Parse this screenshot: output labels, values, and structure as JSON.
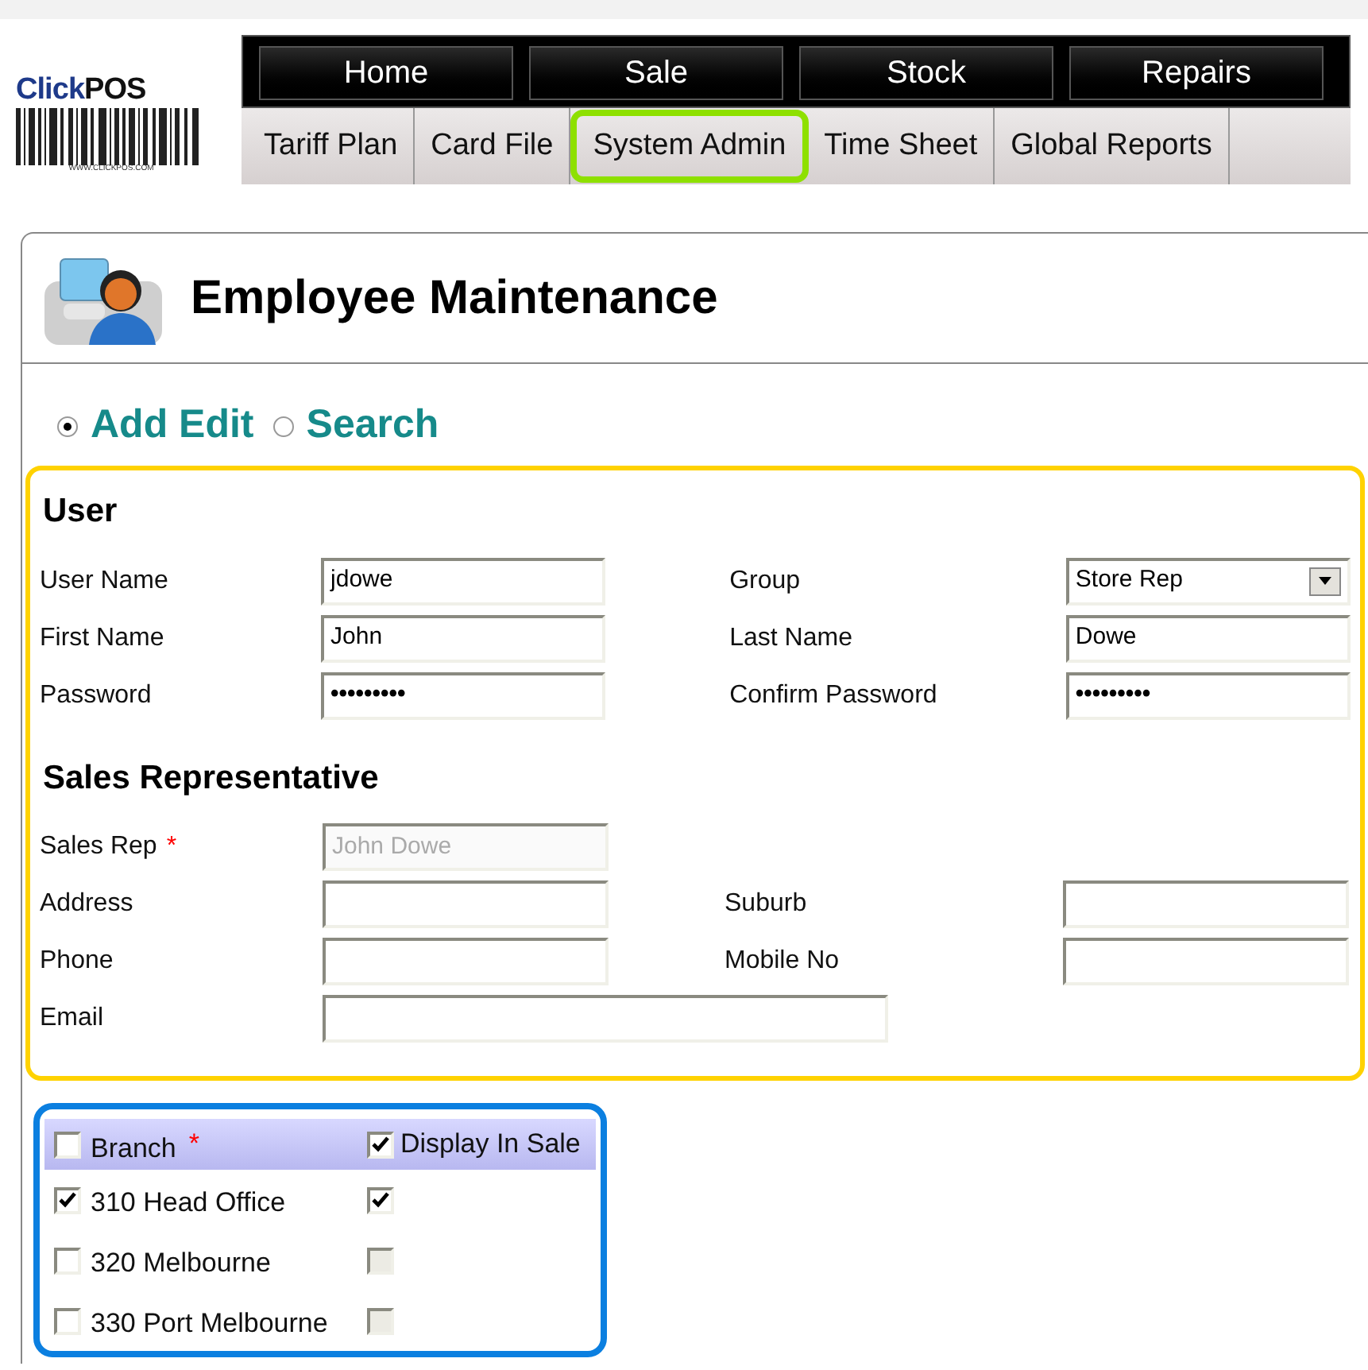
{
  "logo": {
    "brand_first": "Click",
    "brand_second": "POS",
    "tagline": "WWW.CLICKPOS.COM"
  },
  "nav": [
    {
      "label": "Home",
      "selected": false
    },
    {
      "label": "Sale",
      "selected": false
    },
    {
      "label": "Stock",
      "selected": false
    },
    {
      "label": "Repairs",
      "selected": false
    }
  ],
  "subnav": [
    {
      "label": "Tariff Plan",
      "highlighted": false
    },
    {
      "label": "Card File",
      "highlighted": false
    },
    {
      "label": "System Admin",
      "highlighted": true
    },
    {
      "label": "Time Sheet",
      "highlighted": false
    },
    {
      "label": "Global Reports",
      "highlighted": false
    }
  ],
  "page": {
    "title": "Employee Maintenance"
  },
  "modes": [
    {
      "label": "Add Edit",
      "selected": true
    },
    {
      "label": "Search",
      "selected": false
    }
  ],
  "user_section": {
    "title": "User",
    "rows": [
      [
        {
          "label": "User Name",
          "value": "jdowe",
          "kind": "text"
        },
        {
          "label": "Group",
          "value": "Store Rep",
          "kind": "select"
        }
      ],
      [
        {
          "label": "First Name",
          "value": "John",
          "kind": "text"
        },
        {
          "label": "Last Name",
          "value": "Dowe",
          "kind": "text"
        }
      ],
      [
        {
          "label": "Password",
          "value": "•••••••••",
          "kind": "password"
        },
        {
          "label": "Confirm Password",
          "value": "•••••••••",
          "kind": "password"
        }
      ]
    ]
  },
  "sales_section": {
    "title": "Sales Representative",
    "rows": [
      [
        {
          "label": "Sales Rep",
          "required_mark": "*",
          "value": "John Dowe",
          "disabled": true,
          "kind": "text"
        }
      ],
      [
        {
          "label": "Address",
          "kind": "text"
        },
        {
          "label": "Suburb",
          "kind": "text"
        }
      ],
      [
        {
          "label": "Phone",
          "kind": "text"
        },
        {
          "label": "Mobile No",
          "kind": "text"
        }
      ],
      [
        {
          "label": "Email",
          "kind": "wide"
        }
      ]
    ]
  },
  "branches": {
    "header": {
      "branch_label": "Branch",
      "required_mark": "*",
      "branch_checked": false,
      "display_label": "Display In Sale",
      "display_checked": true
    },
    "rows": [
      {
        "name": "310 Head Office",
        "checked": true,
        "display_checked": true,
        "display_disabled": false
      },
      {
        "name": "320 Melbourne",
        "checked": false,
        "display_checked": false,
        "display_disabled": true
      },
      {
        "name": "330 Port Melbourne",
        "checked": false,
        "display_checked": false,
        "display_disabled": true
      }
    ]
  }
}
